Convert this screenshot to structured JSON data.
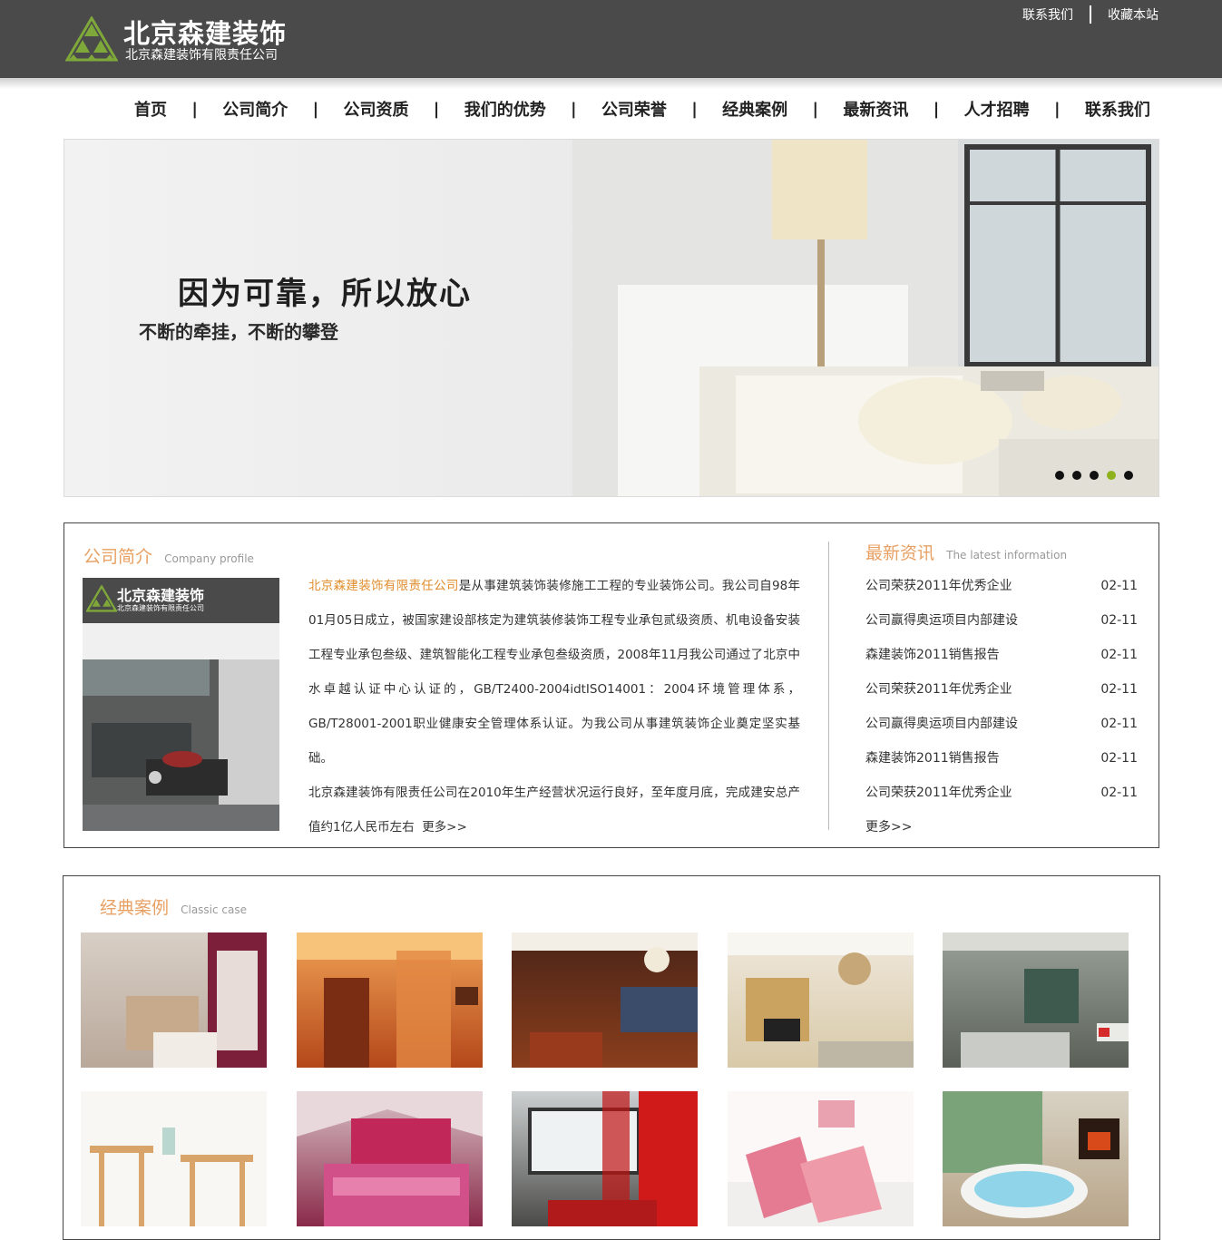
{
  "header": {
    "logo_title": "北京森建装饰",
    "logo_subtitle": "北京森建装饰有限责任公司",
    "top_links": [
      "联系我们",
      "收藏本站"
    ]
  },
  "nav": {
    "items": [
      "首页",
      "公司简介",
      "公司资质",
      "我们的优势",
      "公司荣誉",
      "经典案例",
      "最新资讯",
      "人才招聘",
      "联系我们"
    ],
    "separator": "|"
  },
  "banner": {
    "slogan_main": "因为可靠，所以放心",
    "slogan_sub": "不断的牵挂，不断的攀登",
    "slide_count": 5,
    "active_slide": 4
  },
  "profile": {
    "title_cn": "公司简介",
    "title_en": "Company profile",
    "image_logo_title": "北京森建装饰",
    "image_logo_subtitle": "北京森建装饰有限责任公司",
    "company_name": "北京森建装饰有限责任公司",
    "para1_rest": "是从事建筑装饰装修施工工程的专业装饰公司。我公司自98年01月05日成立，被国家建设部核定为建筑装修装饰工程专业承包贰级资质、机电设备安装工程专业承包叁级、建筑智能化工程专业承包叁级资质，2008年11月我公司通过了北京中水卓越认证中心认证的，GB/T2400-2004idtISO14001：2004环境管理体系，GB/T28001-2001职业健康安全管理体系认证。为我公司从事建筑装饰企业奠定坚实基础。",
    "para2": "北京森建装饰有限责任公司在2010年生产经营状况运行良好，至年度月底，完成建安总产值约1亿人民币左右",
    "more": "更多>>"
  },
  "news": {
    "title_cn": "最新资讯",
    "title_en": "The latest information",
    "items": [
      {
        "title": "公司荣获2011年优秀企业",
        "date": "02-11"
      },
      {
        "title": "公司赢得奥运项目内部建设",
        "date": "02-11"
      },
      {
        "title": "森建装饰2011销售报告",
        "date": "02-11"
      },
      {
        "title": "公司荣获2011年优秀企业",
        "date": "02-11"
      },
      {
        "title": "公司赢得奥运项目内部建设",
        "date": "02-11"
      },
      {
        "title": "森建装饰2011销售报告",
        "date": "02-11"
      },
      {
        "title": "公司荣获2011年优秀企业",
        "date": "02-11"
      }
    ],
    "more": "更多>>"
  },
  "cases": {
    "title_cn": "经典案例",
    "title_en": "Classic case"
  },
  "colors": {
    "header_bg": "#4a4a4a",
    "accent_orange": "#e8a063",
    "logo_green": "#8db21c",
    "active_dot": "#8db21c"
  }
}
